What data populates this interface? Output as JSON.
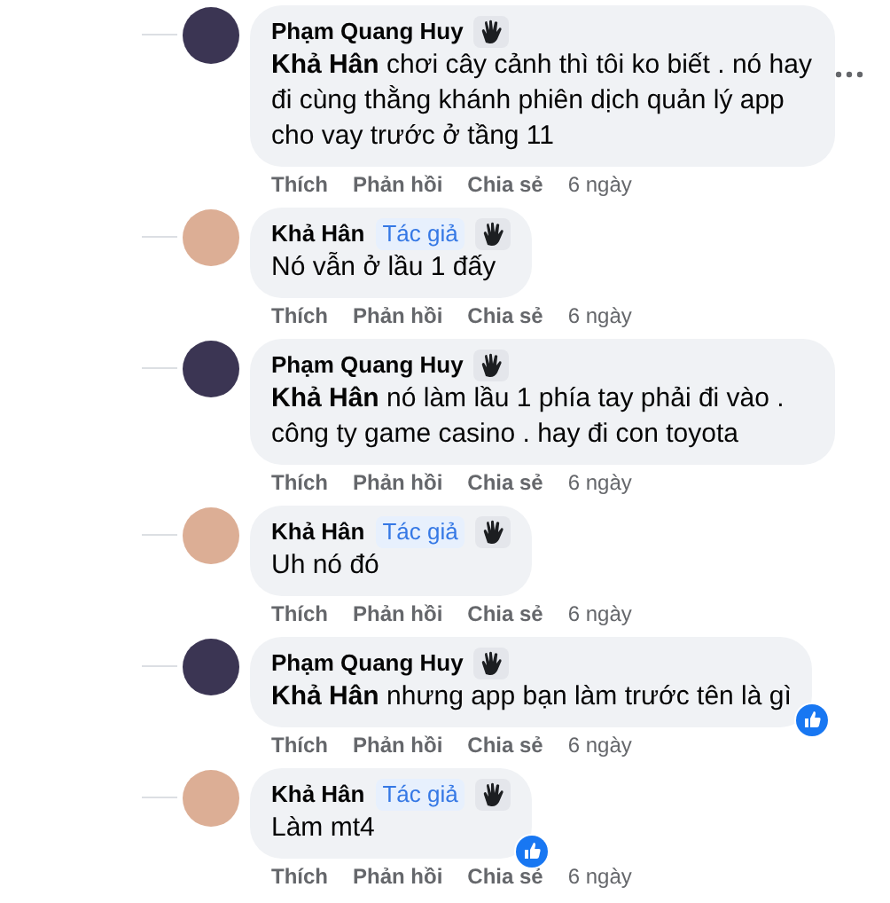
{
  "comments": [
    {
      "author": "Phạm Quang Huy",
      "color": "#3b3553",
      "text": "**Khả Hân** chơi cây cảnh thì tôi ko biết . nó hay đi cùng thằng khánh phiên dịch quản lý app cho vay trước ở tầng 11",
      "liked": false,
      "menu_shown": true,
      "actions": [
        "Thích",
        "Phản hồi",
        "Chia sẻ"
      ],
      "time": "6 ngày"
    },
    {
      "author": "Khả Hân",
      "color": "#dcae95",
      "badge": "Tác giả",
      "text": "Nó vẫn ở lầu 1 đấy",
      "liked": false,
      "menu_shown": false,
      "actions": [
        "Thích",
        "Phản hồi",
        "Chia sẻ"
      ],
      "time": "6 ngày"
    },
    {
      "author": "Phạm Quang Huy",
      "color": "#3b3553",
      "text": "**Khả Hân** nó làm lầu 1 phía tay phải đi vào . công ty game casino . hay đi con toyota",
      "liked": false,
      "menu_shown": false,
      "actions": [
        "Thích",
        "Phản hồi",
        "Chia sẻ"
      ],
      "time": "6 ngày"
    },
    {
      "author": "Khả Hân",
      "color": "#dcae95",
      "badge": "Tác giả",
      "text": "Uh nó đó",
      "liked": false,
      "menu_shown": false,
      "actions": [
        "Thích",
        "Phản hồi",
        "Chia sẻ"
      ],
      "time": "6 ngày"
    },
    {
      "author": "Phạm Quang Huy",
      "color": "#3b3553",
      "text": "**Khả Hân** nhưng app bạn làm trước tên là gì",
      "liked": true,
      "menu_shown": false,
      "actions": [
        "Thích",
        "Phản hồi",
        "Chia sẻ"
      ],
      "time": "6 ngày"
    },
    {
      "author": "Khả Hân",
      "color": "#dcae95",
      "badge": "Tác giả",
      "text": "Làm mt4",
      "liked": true,
      "menu_shown": false,
      "actions": [
        "Thích",
        "Phản hồi",
        "Chia sẻ"
      ],
      "time": "6 ngày"
    }
  ]
}
